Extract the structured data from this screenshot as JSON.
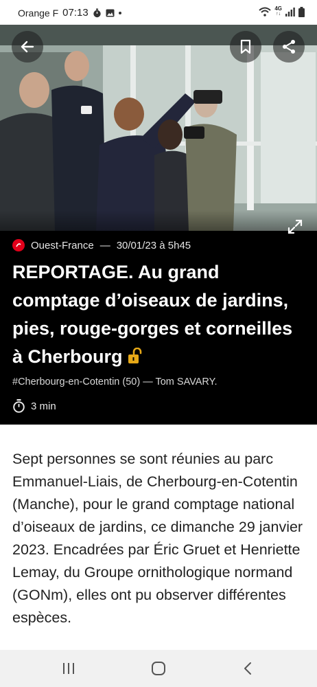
{
  "status_bar": {
    "carrier": "Orange F",
    "time": "07:13",
    "network": "4G"
  },
  "hero": {
    "source": "Ouest-France",
    "separator": "—",
    "date": "30/01/23 à 5h45",
    "headline": "REPORTAGE. Au grand comptage d’oiseaux de jardins, pies, rouge-gorges et corneilles à Cherbourg",
    "tags": "#Cherbourg-en-Cotentin (50) — Tom SAVARY.",
    "read_time": "3 min",
    "brand_color": "#e2001a",
    "lock_color": "#e6a817"
  },
  "article": {
    "paragraph": "Sept personnes se sont réunies au parc Emmanuel-Liais, de Cherbourg-en-Cotentin (Manche), pour le grand comptage national d’oiseaux de jardins, ce dimanche 29 janvier 2023. Encadrées par Éric Gruet et Henriette Lemay, du Groupe ornithologique normand (GONm), elles ont pu observer différentes espèces."
  },
  "icons": {
    "back": "arrow-left-icon",
    "bookmark": "bookmark-icon",
    "share": "share-icon",
    "expand": "expand-icon",
    "timer": "timer-icon",
    "lock": "unlocked-icon"
  }
}
